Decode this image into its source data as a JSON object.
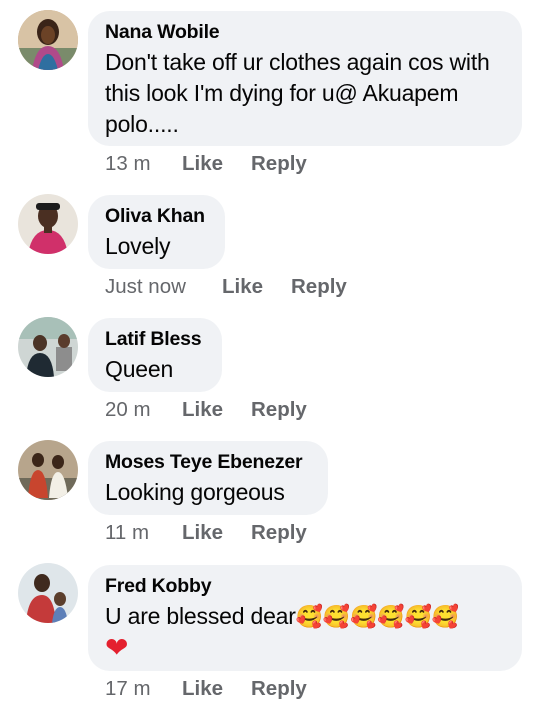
{
  "comments": [
    {
      "author": "Nana Wobile",
      "text": "Don't take off ur clothes again cos with this look I'm dying for u@ Akuapem polo.....",
      "time": "13 m",
      "like_label": "Like",
      "reply_label": "Reply",
      "avatar_icon": "profile-photo-woman"
    },
    {
      "author": "Oliva Khan",
      "text": "Lovely",
      "time": "Just now",
      "like_label": "Like",
      "reply_label": "Reply",
      "avatar_icon": "profile-photo-man"
    },
    {
      "author": "Latif Bless",
      "text": "Queen",
      "time": "20 m",
      "like_label": "Like",
      "reply_label": "Reply",
      "avatar_icon": "profile-photo-outdoor"
    },
    {
      "author": "Moses Teye Ebenezer",
      "text": "Looking gorgeous",
      "time": "11 m",
      "like_label": "Like",
      "reply_label": "Reply",
      "avatar_icon": "profile-photo-group"
    },
    {
      "author": "Fred Kobby",
      "text": "U are blessed dear",
      "emojis": "🥰🥰🥰🥰🥰🥰",
      "heart": "❤",
      "time": "17 m",
      "like_label": "Like",
      "reply_label": "Reply",
      "avatar_icon": "profile-photo-man-child"
    }
  ],
  "colors": {
    "bubble_bg": "#f0f2f5",
    "meta_text": "#65676b",
    "heart": "#e4202e"
  }
}
